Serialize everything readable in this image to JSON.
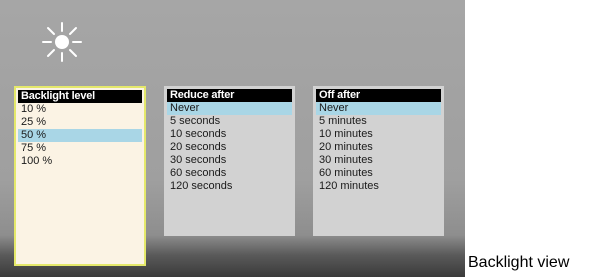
{
  "screen": {
    "icon": "brightness-sun-icon"
  },
  "panels": [
    {
      "title": "Backlight level",
      "items": [
        "10 %",
        "25 %",
        "50 %",
        "75 %",
        "100 %"
      ],
      "selected_index": 2,
      "focused": true
    },
    {
      "title": "Reduce after",
      "items": [
        "Never",
        "5 seconds",
        "10 seconds",
        "20 seconds",
        "30 seconds",
        "60 seconds",
        "120 seconds"
      ],
      "selected_index": 0,
      "focused": false
    },
    {
      "title": "Off after",
      "items": [
        "Never",
        "5 minutes",
        "10 minutes",
        "20 minutes",
        "30 minutes",
        "60 minutes",
        "120 minutes"
      ],
      "selected_index": 0,
      "focused": false
    }
  ],
  "colors": {
    "highlight": "#a9d6e6",
    "focus_border": "#e4e86a",
    "header_bg": "#000000"
  },
  "caption": "Backlight view"
}
